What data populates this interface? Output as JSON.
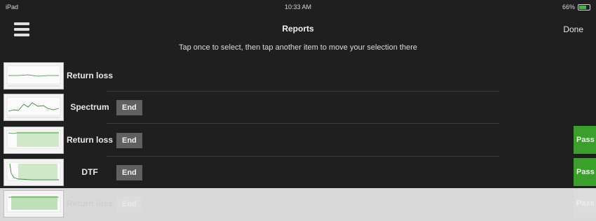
{
  "status_bar": {
    "carrier": "iPad",
    "time": "10:33 AM",
    "battery": "66%",
    "battery_color": "#4caf50"
  },
  "nav": {
    "title": "Reports",
    "done_label": "Done",
    "instruction": "Tap once to select, then tap another item to move your selection there"
  },
  "colors": {
    "background": "#1f1f1f",
    "selected_row": "#d9d9d9",
    "pass_green": "#3ba02b",
    "end_button": "#606060"
  },
  "rows": [
    {
      "label": "Return loss",
      "end_label": "",
      "pass_label": "",
      "selected": false
    },
    {
      "label": "Spectrum",
      "end_label": "End",
      "pass_label": "",
      "selected": false
    },
    {
      "label": "Return loss",
      "end_label": "End",
      "pass_label": "Pass",
      "selected": false
    },
    {
      "label": "DTF",
      "end_label": "End",
      "pass_label": "Pass",
      "selected": false
    },
    {
      "label": "Return loss",
      "end_label": "End",
      "pass_label": "Pass",
      "selected": true
    }
  ]
}
